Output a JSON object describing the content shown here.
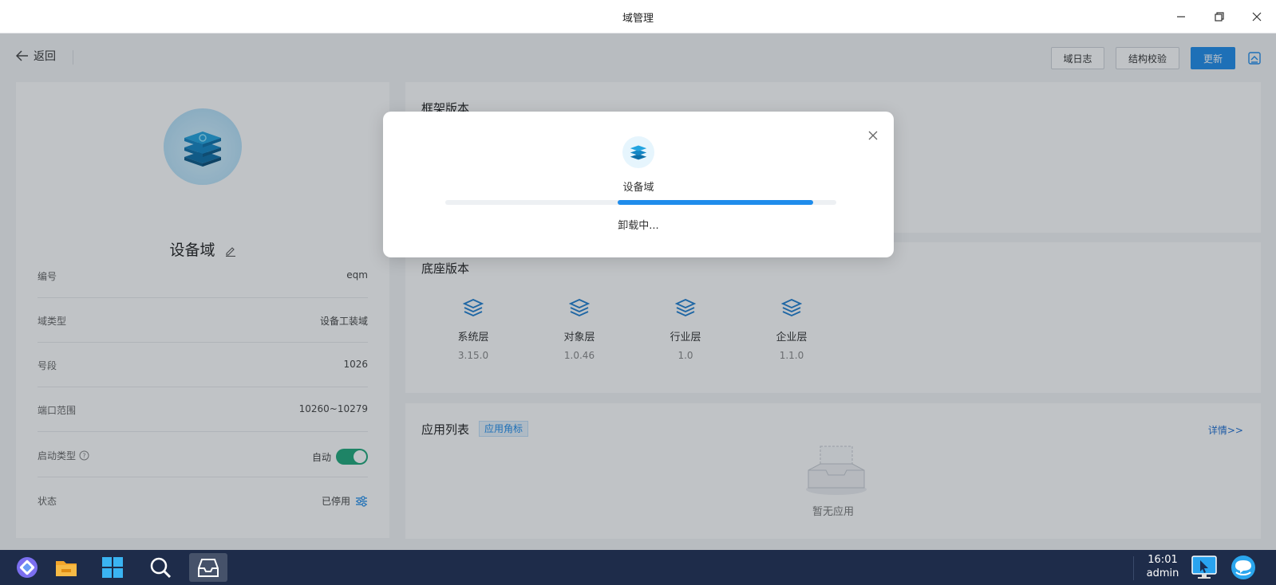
{
  "window": {
    "title": "域管理"
  },
  "toolbar": {
    "back_label": "返回",
    "buttons": [
      {
        "label": "域日志"
      },
      {
        "label": "结构校验"
      },
      {
        "label": "更新"
      }
    ]
  },
  "domain": {
    "name": "设备域",
    "fields": [
      {
        "label": "编号",
        "value": "eqm"
      },
      {
        "label": "域类型",
        "value": "设备工装域"
      },
      {
        "label": "号段",
        "value": "1026"
      },
      {
        "label": "端口范围",
        "value": "10260~10279"
      },
      {
        "label": "启动类型",
        "value": "自动",
        "toggle_on": true
      },
      {
        "label": "状态",
        "value": "已停用"
      }
    ]
  },
  "sections": {
    "framework_title": "框架版本",
    "base_title": "底座版本",
    "base_layers": [
      {
        "name": "系统层",
        "version": "3.15.0"
      },
      {
        "name": "对象层",
        "version": "1.0.46"
      },
      {
        "name": "行业层",
        "version": "1.0"
      },
      {
        "name": "企业层",
        "version": "1.1.0"
      }
    ],
    "apps_title": "应用列表",
    "apps_badge": "应用角标",
    "apps_detail_link": "详情>>",
    "apps_empty": "暂无应用"
  },
  "modal": {
    "name": "设备域",
    "status": "卸载中...",
    "progress": {
      "start": 0.44,
      "end": 0.94
    }
  },
  "taskbar": {
    "time": "16:01",
    "user": "admin"
  },
  "colors": {
    "primary": "#1f8ceb",
    "toggle": "#1fa87a",
    "taskbar": "#1e2c4a"
  }
}
